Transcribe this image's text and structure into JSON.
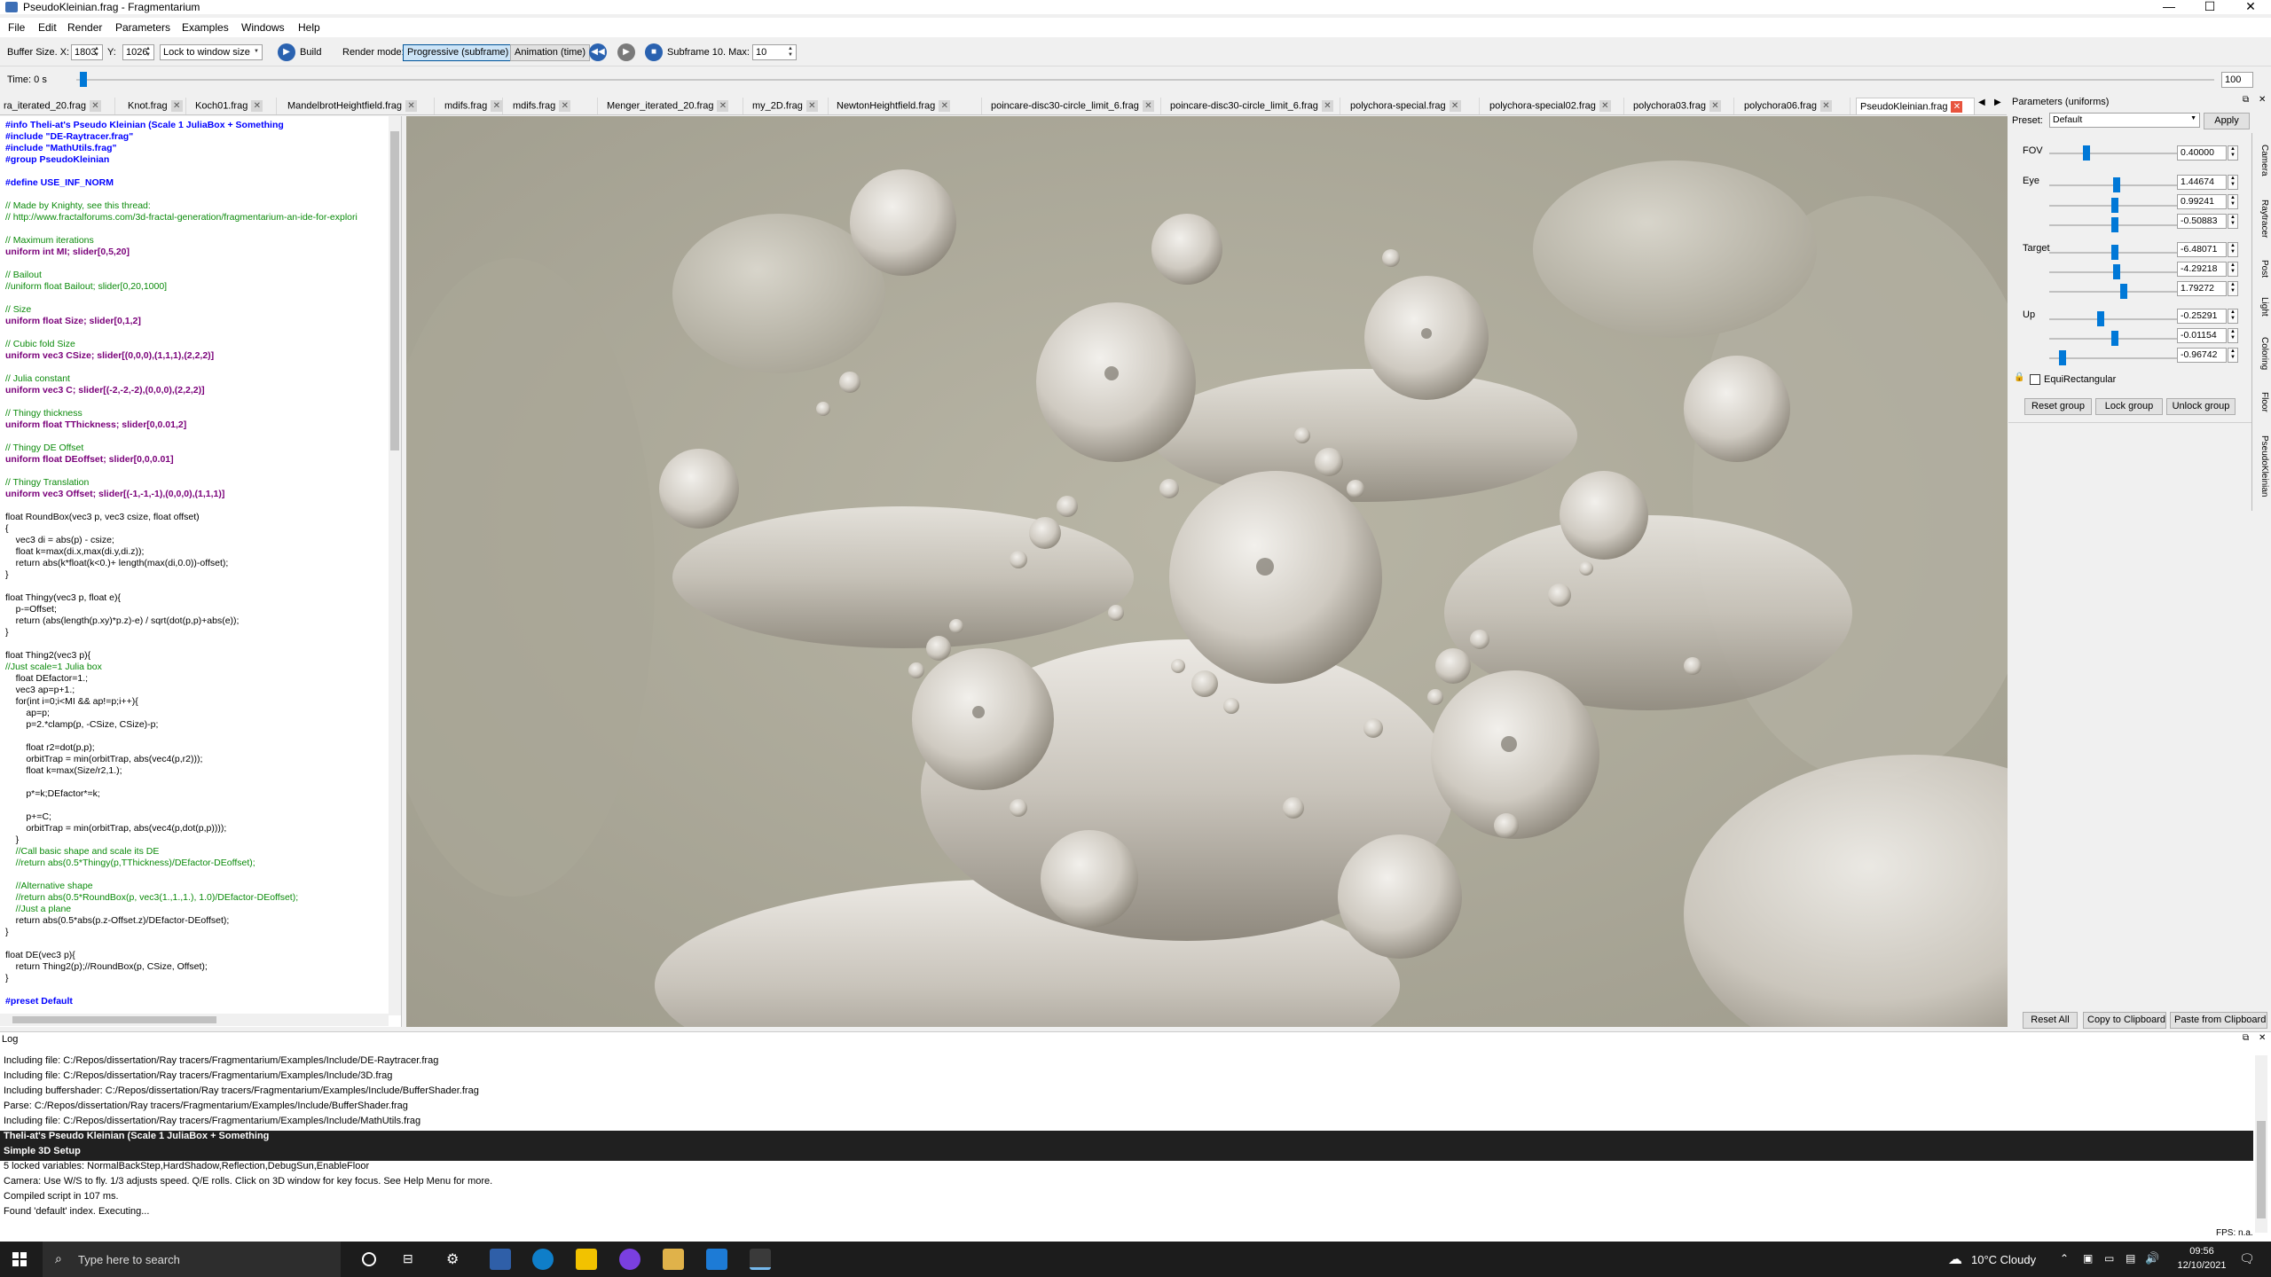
{
  "window": {
    "title": "PseudoKleinian.frag - Fragmentarium",
    "controls": [
      "—",
      "☐",
      "✕"
    ]
  },
  "menu": [
    "File",
    "Edit",
    "Render",
    "Parameters",
    "Examples",
    "Windows",
    "Help"
  ],
  "toolbar": {
    "buffer_size_label": "Buffer Size. X:",
    "x_value": "1803",
    "y_label": "Y:",
    "y_value": "1026",
    "lock_select": "Lock to window size",
    "build_label": "Build",
    "render_mode_label": "Render mode:",
    "progressive_label": "Progressive (subframe)",
    "animation_label": "Animation (time)",
    "subframe_label": "Subframe 10. Max:",
    "max_value": "10"
  },
  "timebar": {
    "time_label": "Time: 0 s",
    "end_value": "100"
  },
  "tabs": [
    {
      "label": "ra_iterated_20.frag",
      "active": false
    },
    {
      "label": "Knot.frag",
      "active": false
    },
    {
      "label": "Koch01.frag",
      "active": false
    },
    {
      "label": "MandelbrotHeightfield.frag",
      "active": false
    },
    {
      "label": "mdifs.frag",
      "active": false
    },
    {
      "label": "mdifs.frag",
      "active": false
    },
    {
      "label": "Menger_iterated_20.frag",
      "active": false
    },
    {
      "label": "my_2D.frag",
      "active": false
    },
    {
      "label": "NewtonHeightfield.frag",
      "active": false
    },
    {
      "label": "poincare-disc30-circle_limit_6.frag",
      "active": false
    },
    {
      "label": "poincare-disc30-circle_limit_6.frag",
      "active": false
    },
    {
      "label": "polychora-special.frag",
      "active": false
    },
    {
      "label": "polychora-special02.frag",
      "active": false
    },
    {
      "label": "polychora03.frag",
      "active": false
    },
    {
      "label": "polychora06.frag",
      "active": false
    },
    {
      "label": "PseudoKleinian.frag",
      "active": true
    }
  ],
  "code": [
    {
      "t": "pre",
      "s": "#info Theli-at's Pseudo Kleinian (Scale 1 JuliaBox + Something"
    },
    {
      "t": "pre",
      "s": "#include \"DE-Raytracer.frag\""
    },
    {
      "t": "pre",
      "s": "#include \"MathUtils.frag\""
    },
    {
      "t": "pre",
      "s": "#group PseudoKleinian"
    },
    {
      "t": "n",
      "s": ""
    },
    {
      "t": "pre",
      "s": "#define USE_INF_NORM"
    },
    {
      "t": "n",
      "s": ""
    },
    {
      "t": "com",
      "s": "// Made by Knighty, see this thread:"
    },
    {
      "t": "com",
      "s": "// http://www.fractalforums.com/3d-fractal-generation/fragmentarium-an-ide-for-explori"
    },
    {
      "t": "n",
      "s": ""
    },
    {
      "t": "com",
      "s": "// Maximum iterations"
    },
    {
      "t": "kw",
      "s": "uniform int MI; slider[0,5,20]"
    },
    {
      "t": "n",
      "s": ""
    },
    {
      "t": "com",
      "s": "// Bailout"
    },
    {
      "t": "com",
      "s": "//uniform float Bailout; slider[0,20,1000]"
    },
    {
      "t": "n",
      "s": ""
    },
    {
      "t": "com",
      "s": "// Size"
    },
    {
      "t": "kw",
      "s": "uniform float Size; slider[0,1,2]"
    },
    {
      "t": "n",
      "s": ""
    },
    {
      "t": "com",
      "s": "// Cubic fold Size"
    },
    {
      "t": "kw",
      "s": "uniform vec3 CSize; slider[(0,0,0),(1,1,1),(2,2,2)]"
    },
    {
      "t": "n",
      "s": ""
    },
    {
      "t": "com",
      "s": "// Julia constant"
    },
    {
      "t": "kw",
      "s": "uniform vec3 C; slider[(-2,-2,-2),(0,0,0),(2,2,2)]"
    },
    {
      "t": "n",
      "s": ""
    },
    {
      "t": "com",
      "s": "// Thingy thickness"
    },
    {
      "t": "kw",
      "s": "uniform float TThickness; slider[0,0.01,2]"
    },
    {
      "t": "n",
      "s": ""
    },
    {
      "t": "com",
      "s": "// Thingy DE Offset"
    },
    {
      "t": "kw",
      "s": "uniform float DEoffset; slider[0,0,0.01]"
    },
    {
      "t": "n",
      "s": ""
    },
    {
      "t": "com",
      "s": "// Thingy Translation"
    },
    {
      "t": "kw",
      "s": "uniform vec3 Offset; slider[(-1,-1,-1),(0,0,0),(1,1,1)]"
    },
    {
      "t": "n",
      "s": ""
    },
    {
      "t": "n",
      "s": "float RoundBox(vec3 p, vec3 csize, float offset)"
    },
    {
      "t": "n",
      "s": "{"
    },
    {
      "t": "n",
      "s": "    vec3 di = abs(p) - csize;"
    },
    {
      "t": "n",
      "s": "    float k=max(di.x,max(di.y,di.z));"
    },
    {
      "t": "n",
      "s": "    return abs(k*float(k<0.)+ length(max(di,0.0))-offset);"
    },
    {
      "t": "n",
      "s": "}"
    },
    {
      "t": "n",
      "s": ""
    },
    {
      "t": "n",
      "s": "float Thingy(vec3 p, float e){"
    },
    {
      "t": "n",
      "s": "    p-=Offset;"
    },
    {
      "t": "n",
      "s": "    return (abs(length(p.xy)*p.z)-e) / sqrt(dot(p,p)+abs(e));"
    },
    {
      "t": "n",
      "s": "}"
    },
    {
      "t": "n",
      "s": ""
    },
    {
      "t": "n",
      "s": "float Thing2(vec3 p){"
    },
    {
      "t": "com",
      "s": "//Just scale=1 Julia box"
    },
    {
      "t": "n",
      "s": "    float DEfactor=1.;"
    },
    {
      "t": "n",
      "s": "    vec3 ap=p+1.;"
    },
    {
      "t": "n",
      "s": "    for(int i=0;i<MI && ap!=p;i++){"
    },
    {
      "t": "n",
      "s": "        ap=p;"
    },
    {
      "t": "n",
      "s": "        p=2.*clamp(p, -CSize, CSize)-p;"
    },
    {
      "t": "n",
      "s": ""
    },
    {
      "t": "n",
      "s": "        float r2=dot(p,p);"
    },
    {
      "t": "n",
      "s": "        orbitTrap = min(orbitTrap, abs(vec4(p,r2)));"
    },
    {
      "t": "n",
      "s": "        float k=max(Size/r2,1.);"
    },
    {
      "t": "n",
      "s": ""
    },
    {
      "t": "n",
      "s": "        p*=k;DEfactor*=k;"
    },
    {
      "t": "n",
      "s": ""
    },
    {
      "t": "n",
      "s": "        p+=C;"
    },
    {
      "t": "n",
      "s": "        orbitTrap = min(orbitTrap, abs(vec4(p,dot(p,p))));"
    },
    {
      "t": "n",
      "s": "    }"
    },
    {
      "t": "com",
      "s": "    //Call basic shape and scale its DE"
    },
    {
      "t": "com",
      "s": "    //return abs(0.5*Thingy(p,TThickness)/DEfactor-DEoffset);"
    },
    {
      "t": "n",
      "s": ""
    },
    {
      "t": "com",
      "s": "    //Alternative shape"
    },
    {
      "t": "com",
      "s": "    //return abs(0.5*RoundBox(p, vec3(1.,1.,1.), 1.0)/DEfactor-DEoffset);"
    },
    {
      "t": "com",
      "s": "    //Just a plane"
    },
    {
      "t": "n",
      "s": "    return abs(0.5*abs(p.z-Offset.z)/DEfactor-DEoffset);"
    },
    {
      "t": "n",
      "s": "}"
    },
    {
      "t": "n",
      "s": ""
    },
    {
      "t": "n",
      "s": "float DE(vec3 p){"
    },
    {
      "t": "n",
      "s": "    return Thing2(p);//RoundBox(p, CSize, Offset);"
    },
    {
      "t": "n",
      "s": "}"
    },
    {
      "t": "n",
      "s": ""
    },
    {
      "t": "pre",
      "s": "#preset Default"
    }
  ],
  "params": {
    "header": "Parameters (uniforms)",
    "preset_label": "Preset:",
    "preset_value": "Default",
    "apply_label": "Apply",
    "fov_label": "FOV",
    "fov": "0.40000",
    "eye_label": "Eye",
    "eye": [
      "1.44674",
      "0.99241",
      "-0.50883"
    ],
    "target_label": "Target",
    "target": [
      "-6.48071",
      "-4.29218",
      "1.79272"
    ],
    "up_label": "Up",
    "up": [
      "-0.25291",
      "-0.01154",
      "-0.96742"
    ],
    "equirect_label": "EquiRectangular",
    "reset_group": "Reset group",
    "lock_group": "Lock group",
    "unlock_group": "Unlock group",
    "reset_all": "Reset All",
    "copy_clipboard": "Copy to Clipboard",
    "paste_clipboard": "Paste from Clipboard",
    "vtabs": [
      "Camera",
      "Raytracer",
      "Post",
      "Light",
      "Coloring",
      "Floor",
      "PseudoKleinian"
    ]
  },
  "log": {
    "title": "Log",
    "lines": [
      {
        "s": "Including file: C:/Repos/dissertation/Ray tracers/Fragmentarium/Examples/Include/DE-Raytracer.frag",
        "hl": false
      },
      {
        "s": "Including file: C:/Repos/dissertation/Ray tracers/Fragmentarium/Examples/Include/3D.frag",
        "hl": false
      },
      {
        "s": "Including buffershader: C:/Repos/dissertation/Ray tracers/Fragmentarium/Examples/Include/BufferShader.frag",
        "hl": false
      },
      {
        "s": "Parse: C:/Repos/dissertation/Ray tracers/Fragmentarium/Examples/Include/BufferShader.frag",
        "hl": false
      },
      {
        "s": "Including file: C:/Repos/dissertation/Ray tracers/Fragmentarium/Examples/Include/MathUtils.frag",
        "hl": false
      },
      {
        "s": "Theli-at's Pseudo Kleinian (Scale 1 JuliaBox + Something",
        "hl": true
      },
      {
        "s": "Simple 3D Setup",
        "hl": true
      },
      {
        "s": "5 locked variables: NormalBackStep,HardShadow,Reflection,DebugSun,EnableFloor",
        "hl": false
      },
      {
        "s": "Camera: Use W/S to fly. 1/3 adjusts speed. Q/E rolls. Click on 3D window for key focus. See Help Menu for more.",
        "hl": false
      },
      {
        "s": "Compiled script in 107 ms.",
        "hl": false
      },
      {
        "s": "Found 'default' index. Executing...",
        "hl": false
      }
    ],
    "fps": "FPS: n.a."
  },
  "taskbar": {
    "search_placeholder": "Type here to search",
    "weather": "10°C  Cloudy",
    "time": "09:56",
    "date": "12/10/2021"
  }
}
